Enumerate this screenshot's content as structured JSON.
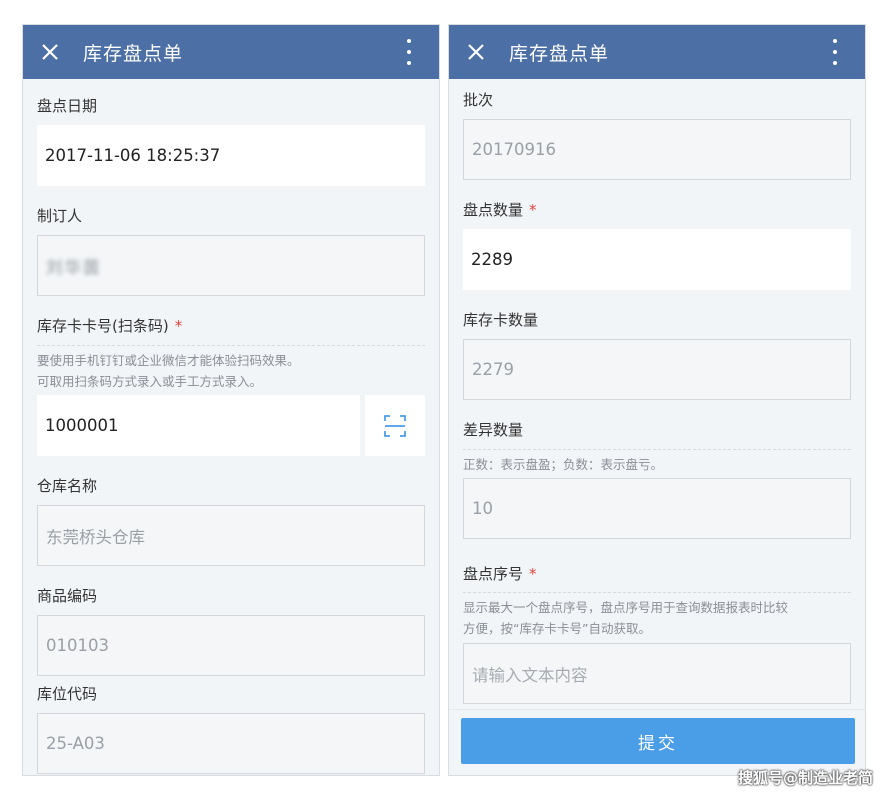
{
  "left": {
    "title": "库存盘点单",
    "fields": {
      "date_label": "盘点日期",
      "date_value": "2017-11-06 18:25:37",
      "maker_label": "制订人",
      "maker_value": "刘华茵",
      "card_label": "库存卡卡号(扫条码)",
      "card_required": "*",
      "card_hint_1": "要使用手机钉钉或企业微信才能体验扫码效果。",
      "card_hint_2": "可取用扫条码方式录入或手工方式录入。",
      "card_value": "1000001",
      "warehouse_label": "仓库名称",
      "warehouse_value": "东莞桥头仓库",
      "product_code_label": "商品编码",
      "product_code_value": "010103",
      "location_label": "库位代码",
      "location_value": "25-A03"
    }
  },
  "right": {
    "title": "库存盘点单",
    "fields": {
      "batch_label": "批次",
      "batch_value": "20170916",
      "count_label": "盘点数量",
      "count_required": "*",
      "count_value": "2289",
      "card_qty_label": "库存卡数量",
      "card_qty_value": "2279",
      "diff_label": "差异数量",
      "diff_hint": "正数：表示盘盈；负数：表示盘亏。",
      "diff_value": "10",
      "seq_label": "盘点序号",
      "seq_required": "*",
      "seq_hint_1": "显示最大一个盘点序号，盘点序号用于查询数据报表时比较",
      "seq_hint_2": "方便，按“库存卡卡号”自动获取。",
      "seq_placeholder": "请输入文本内容"
    },
    "submit_label": "提交"
  },
  "watermark": "搜狐号@制造业老简",
  "colors": {
    "header": "#4c6fa5",
    "submit": "#4a9ee8",
    "required": "#e0453c",
    "background": "#f2f5f8"
  },
  "icons": {
    "close": "close-icon",
    "more": "more-vertical-icon",
    "scan": "scan-barcode-icon"
  }
}
